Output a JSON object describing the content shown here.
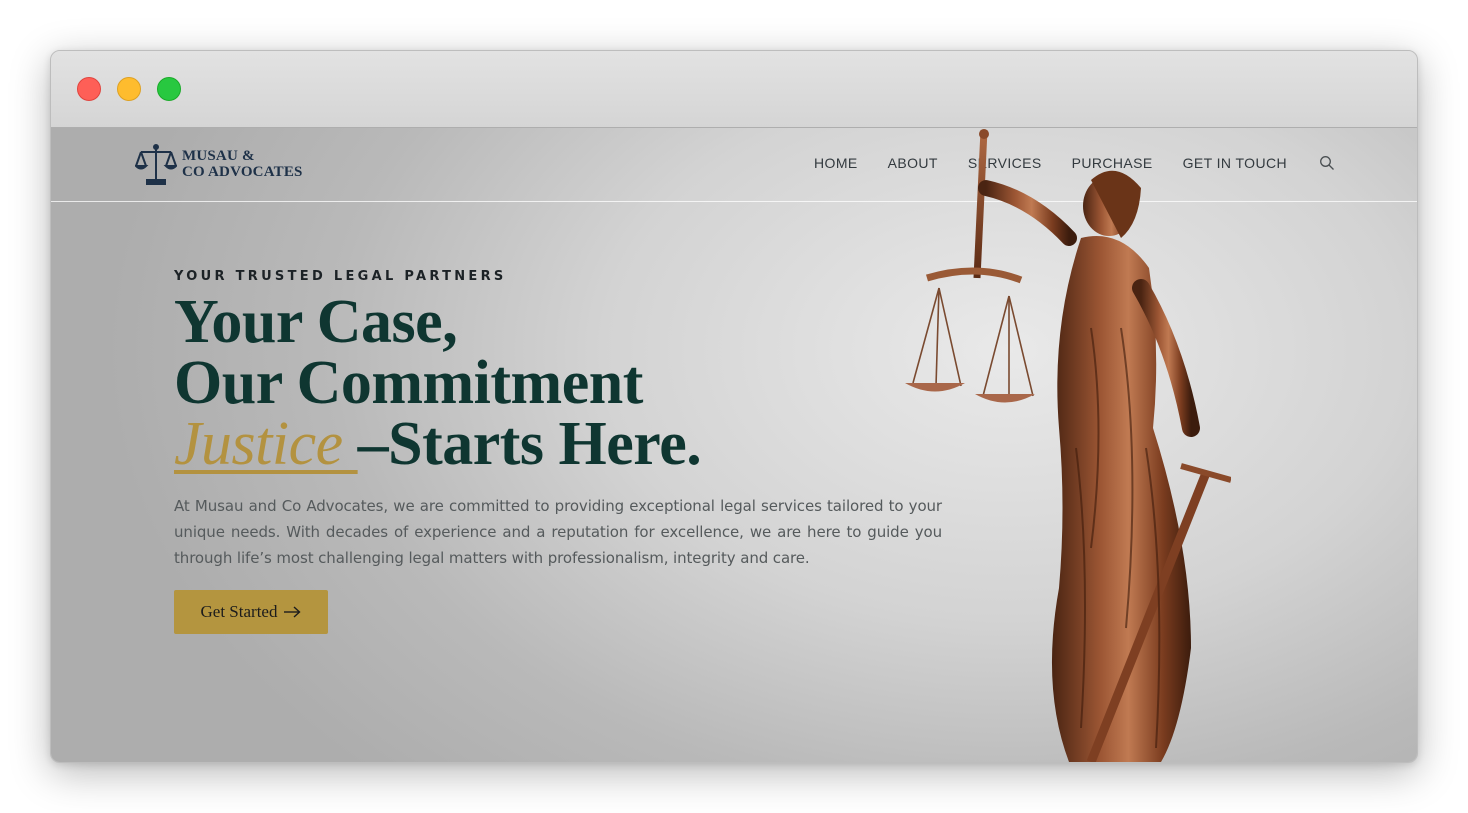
{
  "window": {
    "controls": [
      "close",
      "minimize",
      "maximize"
    ]
  },
  "brand": {
    "line1": "MUSAU &",
    "line2": "CO ADVOCATES",
    "icon": "scales-of-justice-icon",
    "color": "#1e3148"
  },
  "nav": {
    "items": [
      {
        "label": "HOME"
      },
      {
        "label": "ABOUT"
      },
      {
        "label": "SERVICES"
      },
      {
        "label": "PURCHASE"
      },
      {
        "label": "GET IN TOUCH"
      }
    ],
    "search_icon": "search-icon"
  },
  "hero": {
    "eyebrow": "YOUR TRUSTED LEGAL PARTNERS",
    "headline_line1": "Your Case,",
    "headline_line2": "Our Commitment",
    "headline_accent": "Justice ",
    "headline_line3_rest": "–Starts Here.",
    "paragraph": "At Musau and Co Advocates, we are committed to providing exceptional legal services tailored to your unique needs. With decades of experience and a reputation for excellence, we are here to guide you through life’s most challenging legal matters with professionalism, integrity and care.",
    "cta_label": "Get Started",
    "image": "lady-justice-statue"
  },
  "colors": {
    "headline": "#0f3631",
    "accent_gold": "#b39240",
    "button": "#b4953f"
  }
}
